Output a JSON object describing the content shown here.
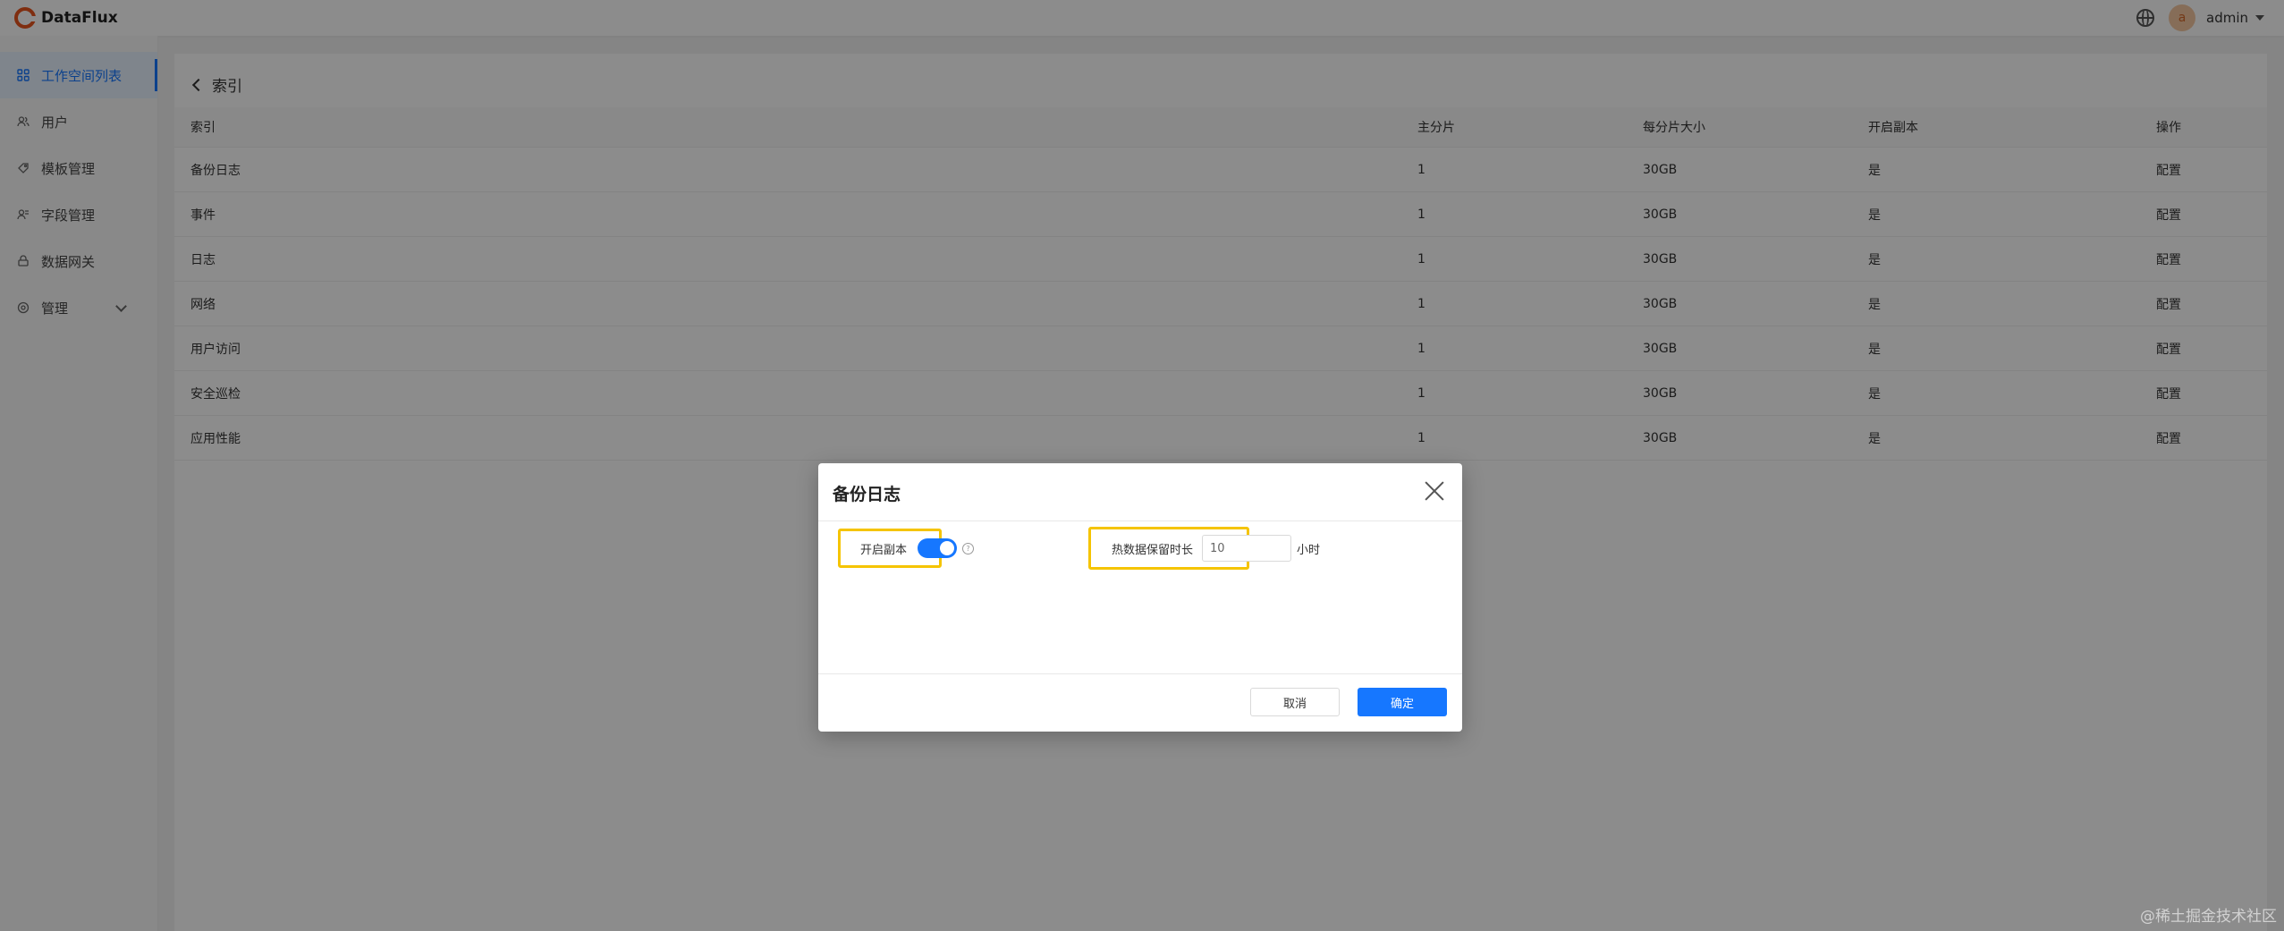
{
  "app": {
    "name": "DataFlux"
  },
  "header": {
    "username": "admin",
    "avatar_letter": "a"
  },
  "sidebar": {
    "items": [
      {
        "label": "工作空间列表",
        "icon": "grid-icon",
        "active": true
      },
      {
        "label": "用户",
        "icon": "users-icon"
      },
      {
        "label": "模板管理",
        "icon": "template-icon"
      },
      {
        "label": "字段管理",
        "icon": "fields-icon"
      },
      {
        "label": "数据网关",
        "icon": "gateway-icon"
      },
      {
        "label": "管理",
        "icon": "settings-icon",
        "expandable": true
      }
    ]
  },
  "main": {
    "breadcrumb": "索引",
    "table": {
      "columns": [
        "索引",
        "主分片",
        "每分片大小",
        "开启副本",
        "操作"
      ],
      "rows": [
        {
          "name": "备份日志",
          "shards": "1",
          "size": "30GB",
          "replica": "是",
          "action": "配置"
        },
        {
          "name": "事件",
          "shards": "1",
          "size": "30GB",
          "replica": "是",
          "action": "配置"
        },
        {
          "name": "日志",
          "shards": "1",
          "size": "30GB",
          "replica": "是",
          "action": "配置"
        },
        {
          "name": "网络",
          "shards": "1",
          "size": "30GB",
          "replica": "是",
          "action": "配置"
        },
        {
          "name": "用户访问",
          "shards": "1",
          "size": "30GB",
          "replica": "是",
          "action": "配置"
        },
        {
          "name": "安全巡检",
          "shards": "1",
          "size": "30GB",
          "replica": "是",
          "action": "配置"
        },
        {
          "name": "应用性能",
          "shards": "1",
          "size": "30GB",
          "replica": "是",
          "action": "配置"
        }
      ]
    }
  },
  "modal": {
    "title": "备份日志",
    "replica_label": "开启副本",
    "replica_enabled": true,
    "hot_label": "热数据保留时长",
    "hot_value": "10",
    "hot_unit": "小时",
    "cancel_label": "取消",
    "ok_label": "确定"
  },
  "colors": {
    "accent": "#1677ff",
    "highlight": "#f5c400",
    "brand": "#e8541e"
  },
  "watermark": "@稀土掘金技术社区"
}
